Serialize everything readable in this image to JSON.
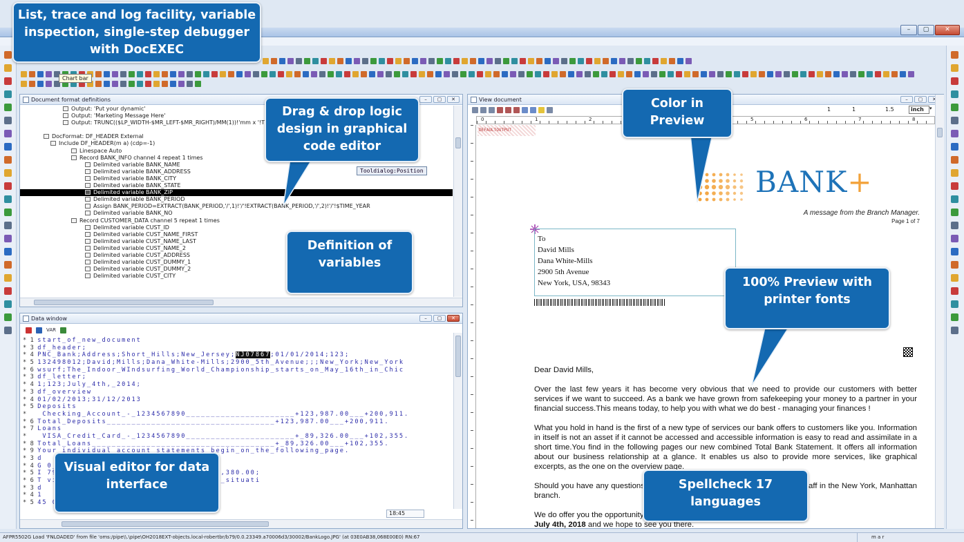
{
  "window": {
    "min_label": "–",
    "max_label": "▢",
    "close_label": "✕"
  },
  "tooltip": {
    "label": "Chart bar"
  },
  "callouts": {
    "title": "List, trace and log facility, variable inspection, single-step debugger with DocEXEC",
    "drag_drop": "Drag & drop logic design in graphical code editor",
    "definition": "Definition of variables",
    "visual_editor": "Visual editor for data interface",
    "color_preview": "Color in Preview",
    "preview_fonts": "100% Preview with printer fonts",
    "spellcheck": "Spellcheck 17 languages"
  },
  "definitions_pane": {
    "title": "Document format definitions",
    "tooldialog": "Tooldialog:Position",
    "lines": [
      {
        "indent": 40,
        "text": "Output: 'Put your dynamic'",
        "selected": false
      },
      {
        "indent": 40,
        "text": "Output: 'Marketing Message Here'",
        "selected": false
      },
      {
        "indent": 40,
        "text": "Output: TRUNC(($LP_WIDTH-$MR_LEFT-$MR_RIGHT)/MM(1))!'mm x '!T",
        "selected": false
      },
      {
        "indent": 0,
        "text": "",
        "selected": false
      },
      {
        "indent": 12,
        "text": "DocFormat: DF_HEADER External",
        "selected": false
      },
      {
        "indent": 22,
        "text": "Include DF_HEADER(m a) (cdp=-1)",
        "selected": false
      },
      {
        "indent": 52,
        "text": "Linespace Auto",
        "selected": false
      },
      {
        "indent": 52,
        "text": "Record BANK_INFO channel 4 repeat 1 times",
        "selected": false
      },
      {
        "indent": 72,
        "text": "Delimited variable BANK_NAME",
        "selected": false
      },
      {
        "indent": 72,
        "text": "Delimited variable BANK_ADDRESS",
        "selected": false
      },
      {
        "indent": 72,
        "text": "Delimited variable BANK_CITY",
        "selected": false
      },
      {
        "indent": 72,
        "text": "Delimited variable BANK_STATE",
        "selected": false
      },
      {
        "indent": 72,
        "text": "Delimited variable BANK_ZIP",
        "selected": true
      },
      {
        "indent": 72,
        "text": "Delimited variable BANK_PERIOD",
        "selected": false
      },
      {
        "indent": 72,
        "text": "Assign BANK_PERIOD=EXTRACT(BANK_PERIOD,'/',1)!'/'!EXTRACT(BANK_PERIOD,'/',2)!'/'!$TIME_YEAR",
        "selected": false
      },
      {
        "indent": 72,
        "text": "Delimited variable BANK_NO",
        "selected": false
      },
      {
        "indent": 52,
        "text": "Record CUSTOMER_DATA channel 5 repeat 1 times",
        "selected": false
      },
      {
        "indent": 72,
        "text": "Delimited variable CUST_ID",
        "selected": false
      },
      {
        "indent": 72,
        "text": "Delimited variable CUST_NAME_FIRST",
        "selected": false
      },
      {
        "indent": 72,
        "text": "Delimited variable CUST_NAME_LAST",
        "selected": false
      },
      {
        "indent": 72,
        "text": "Delimited variable CUST_NAME_2",
        "selected": false
      },
      {
        "indent": 72,
        "text": "Delimited variable CUST_ADDRESS",
        "selected": false
      },
      {
        "indent": 72,
        "text": "Delimited variable CUST_DUMMY_1",
        "selected": false
      },
      {
        "indent": 72,
        "text": "Delimited variable CUST_DUMMY_2",
        "selected": false
      },
      {
        "indent": 72,
        "text": "Delimited variable CUST_CITY",
        "selected": false
      }
    ]
  },
  "data_pane": {
    "title": "Data window",
    "toolbar_var": "VAR",
    "time": "18:45",
    "lines": [
      {
        "ch": "1",
        "pre": "start_of_new_document",
        "hl": "",
        "post": ""
      },
      {
        "ch": "3",
        "pre": "df_header;",
        "hl": "",
        "post": ""
      },
      {
        "ch": "4",
        "pre": "PNC_Bank;Address;Short_Hills;New_Jersey;",
        "hl": "NJ07867",
        "post": ";01/01/2014;123;"
      },
      {
        "ch": "5",
        "pre": "132498012;David;Mills;Dana_White-Mills;2900_5th_Avenue;;;New_York;New_York",
        "hl": "",
        "post": ""
      },
      {
        "ch": "6",
        "pre": "wsurf;The_Indoor_WIndsurfing_World_Championship_starts_on_May_16th_in_Chic",
        "hl": "",
        "post": ""
      },
      {
        "ch": "3",
        "pre": "df_letter;",
        "hl": "",
        "post": ""
      },
      {
        "ch": "4",
        "pre": "1;123;July_4th,_2014;",
        "hl": "",
        "post": ""
      },
      {
        "ch": "3",
        "pre": "df_overview",
        "hl": "",
        "post": ""
      },
      {
        "ch": "4",
        "pre": "01/02/2013;31/12/2013",
        "hl": "",
        "post": ""
      },
      {
        "ch": "5",
        "pre": "Deposits",
        "hl": "",
        "post": ""
      },
      {
        "ch": "",
        "pre": "  Checking_Account_-_1234567890______________________+123,987.00___+200,911.",
        "hl": "",
        "post": ""
      },
      {
        "ch": "6",
        "pre": "Total_Deposits__________________________________+123,987.00___+200,911.",
        "hl": "",
        "post": ""
      },
      {
        "ch": "7",
        "pre": "Loans",
        "hl": "",
        "post": ""
      },
      {
        "ch": "",
        "pre": "  VISA_Credit_Card_-_1234567890______________________+_89,326.00___+102,355.",
        "hl": "",
        "post": ""
      },
      {
        "ch": "8",
        "pre": "Total_Loans_____________________________________+_89,326.00___+102,355.",
        "hl": "",
        "post": ""
      },
      {
        "ch": "9",
        "pre": "Your_individual_account_statements_begin_on_the_following_page.",
        "hl": "",
        "post": ""
      },
      {
        "ch": "3",
        "pre": "d",
        "hl": "",
        "post": ""
      },
      {
        "ch": "4",
        "pre": "G                            0_Finances",
        "hl": "",
        "post": ""
      },
      {
        "ch": "5",
        "pre": "I                            79.49;Interest;712.55;Investments;7,380.00;",
        "hl": "",
        "post": ""
      },
      {
        "ch": "6",
        "pre": "T                            vides_an_overview_of_your_financial_situati",
        "hl": "",
        "post": ""
      },
      {
        "ch": "3",
        "pre": "d",
        "hl": "",
        "post": ""
      },
      {
        "ch": "4",
        "pre": "1",
        "hl": "",
        "post": ""
      },
      {
        "ch": "5",
        "pre": "45                        00;565,910.00",
        "hl": "",
        "post": ""
      }
    ]
  },
  "view_pane": {
    "title": "View document",
    "zoom_values": [
      "1",
      "1",
      "1.5"
    ],
    "unit": "inch",
    "ruler_labels": [
      "0",
      "1",
      "2",
      "3",
      "4",
      "5",
      "6",
      "7",
      "8"
    ],
    "output_tag": "DEFAULTOUTPUT",
    "logo_text": "BANK",
    "logo_plus": "+",
    "tagline": "A message from the Branch Manager.",
    "page_no": "Page 1 of 7",
    "address": [
      "To",
      "David Mills",
      "Dana White-Mills",
      "2900 5th Avenue",
      "New York, USA, 98343"
    ],
    "salutation": "Dear David Mills,",
    "paragraphs": [
      "Over the last  few years it has become very obvious that we need to provide our customers with better services if we want to succeed. As a bank we have grown from safekeeping your money to a partner in your financial success.This  means  today, to help you with what we do best - managing your finances !",
      "What you hold in hand is the first of a new type of services our bank offers to customers like you. Information in itself is not an asset if it cannot be accessed and accessible information is easy to read and assimilate in a short time.You find in the following pages our new combined Total Bank Statement. It offers all information about our business relationship at a glance. It enables us also to provide more services, like graphical excerpts, as the one on the overview page.",
      "Should you have any questions, please do not hesitate to contact me or my staff in the New York, Manhattan branch.",
      "We do offer you the opportunity to learn more about these new services on"
    ],
    "closing_bold": "July 4th, 2018",
    "closing_rest": " and we hope to see you there."
  },
  "status": {
    "text": "AFPR5502G Load 'FNLOADED' from file 'oms:/pipe\\\\.\\pipe\\OH2018EXT-objects.local-robertbr/b79/0.0.23349.a70006d3/30002/BankLogo.JPG' (at 03E0AB38,068E00E0) RN:67",
    "right": "m a r"
  },
  "colors": {
    "callout": "#1469b1",
    "bank_blue": "#1e73b8",
    "bank_orange": "#f2a23a",
    "data_text": "#2a2aa8"
  }
}
